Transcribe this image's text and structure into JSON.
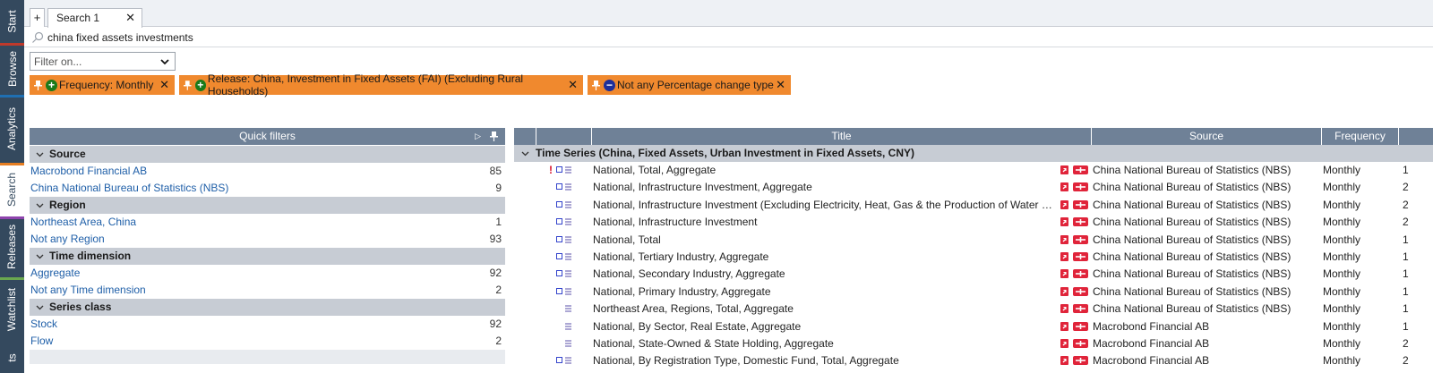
{
  "sidebar": {
    "tabs": [
      {
        "label": "Start",
        "color": "#34495e"
      },
      {
        "label": "Browse",
        "color": "#c0392b"
      },
      {
        "label": "Analytics",
        "color": "#1f6fb2"
      },
      {
        "label": "Search",
        "color": "#e67e22"
      },
      {
        "label": "Releases",
        "color": "#8e44ad"
      },
      {
        "label": "Watchlist",
        "color": "#6aa84f"
      },
      {
        "label": "ts",
        "color": "#34495e"
      }
    ],
    "active": "Search"
  },
  "doc_tabs": {
    "plus_label": "+",
    "tab_label": "Search 1",
    "close_label": "✕"
  },
  "search": {
    "query": "china fixed assets investments",
    "icon": "search-icon"
  },
  "filter_select": {
    "placeholder": "Filter on..."
  },
  "chips": [
    {
      "type": "include",
      "badge": "+",
      "label": "Frequency: Monthly",
      "close": "✕"
    },
    {
      "type": "include",
      "badge": "+",
      "label": "Release: China, Investment in Fixed Assets (FAI) (Excluding Rural Households)",
      "close": "✕"
    },
    {
      "type": "exclude",
      "badge": "−",
      "label": "Not any Percentage change type",
      "close": "✕"
    }
  ],
  "quick_filters": {
    "header": "Quick filters",
    "expand_glyph": "▷",
    "groups": [
      {
        "title": "Source",
        "items": [
          {
            "name": "Macrobond Financial AB",
            "count": "85"
          },
          {
            "name": "China National Bureau of Statistics (NBS)",
            "count": "9"
          }
        ]
      },
      {
        "title": "Region",
        "items": [
          {
            "name": "Northeast Area, China",
            "count": "1"
          },
          {
            "name": "Not any Region",
            "count": "93"
          }
        ]
      },
      {
        "title": "Time dimension",
        "items": [
          {
            "name": "Aggregate",
            "count": "92"
          },
          {
            "name": "Not any Time dimension",
            "count": "2"
          }
        ]
      },
      {
        "title": "Series class",
        "items": [
          {
            "name": "Stock",
            "count": "92"
          },
          {
            "name": "Flow",
            "count": "2"
          }
        ]
      }
    ]
  },
  "grid": {
    "columns": {
      "title": "Title",
      "source": "Source",
      "frequency": "Frequency"
    },
    "group_label": "Time Series (China, Fixed Assets, Urban Investment in Fixed Assets, CNY)",
    "rows": [
      {
        "flag": "!",
        "square": true,
        "title": "National, Total, Aggregate",
        "source": "China National Bureau of Statistics (NBS)",
        "frequency": "Monthly",
        "extra": "1"
      },
      {
        "flag": "",
        "square": true,
        "title": "National, Infrastructure Investment, Aggregate",
        "source": "China National Bureau of Statistics (NBS)",
        "frequency": "Monthly",
        "extra": "2"
      },
      {
        "flag": "",
        "square": true,
        "title": "National, Infrastructure Investment (Excluding Electricity, Heat, Gas & the Production of Water & Su...",
        "source": "China National Bureau of Statistics (NBS)",
        "frequency": "Monthly",
        "extra": "2"
      },
      {
        "flag": "",
        "square": true,
        "title": "National, Infrastructure Investment",
        "source": "China National Bureau of Statistics (NBS)",
        "frequency": "Monthly",
        "extra": "2"
      },
      {
        "flag": "",
        "square": true,
        "title": "National, Total",
        "source": "China National Bureau of Statistics (NBS)",
        "frequency": "Monthly",
        "extra": "1"
      },
      {
        "flag": "",
        "square": true,
        "title": "National, Tertiary Industry, Aggregate",
        "source": "China National Bureau of Statistics (NBS)",
        "frequency": "Monthly",
        "extra": "1"
      },
      {
        "flag": "",
        "square": true,
        "title": "National, Secondary Industry, Aggregate",
        "source": "China National Bureau of Statistics (NBS)",
        "frequency": "Monthly",
        "extra": "1"
      },
      {
        "flag": "",
        "square": true,
        "title": "National, Primary Industry, Aggregate",
        "source": "China National Bureau of Statistics (NBS)",
        "frequency": "Monthly",
        "extra": "1"
      },
      {
        "flag": "",
        "square": false,
        "title": "Northeast Area, Regions, Total, Aggregate",
        "source": "China National Bureau of Statistics (NBS)",
        "frequency": "Monthly",
        "extra": "1"
      },
      {
        "flag": "",
        "square": false,
        "title": "National, By Sector, Real Estate, Aggregate",
        "source": "Macrobond Financial AB",
        "frequency": "Monthly",
        "extra": "1"
      },
      {
        "flag": "",
        "square": false,
        "title": "National, State-Owned & State Holding, Aggregate",
        "source": "Macrobond Financial AB",
        "frequency": "Monthly",
        "extra": "2"
      },
      {
        "flag": "",
        "square": true,
        "title": "National, By Registration Type, Domestic Fund, Total, Aggregate",
        "source": "Macrobond Financial AB",
        "frequency": "Monthly",
        "extra": "2"
      }
    ]
  },
  "colors": {
    "chip": "#f0892e",
    "header": "#6f8197",
    "group": "#c7ccd4",
    "link": "#1f5fa8"
  }
}
